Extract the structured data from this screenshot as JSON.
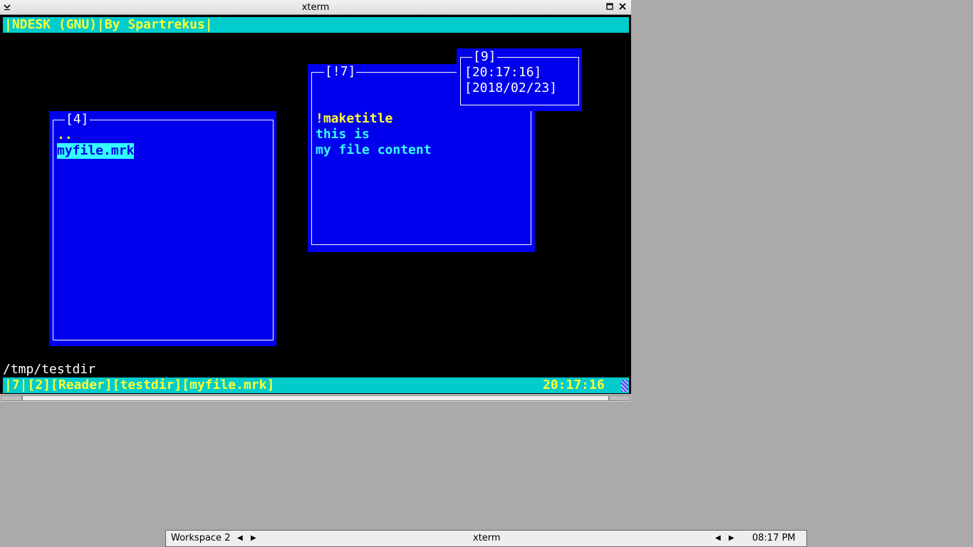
{
  "window": {
    "title": "xterm",
    "menu_icon": "chevron-down-icon",
    "maximize_icon": "maximize-icon",
    "close_icon": "close-icon"
  },
  "terminal": {
    "top_bar": "|NDESK (GNU)|By Spartrekus|",
    "windows": {
      "filelist": {
        "title": "[4]",
        "items": [
          "..",
          "myfile.mrk"
        ]
      },
      "reader": {
        "title": "[!7]",
        "lines": [
          "!maketitle",
          "this is",
          "my file content"
        ]
      },
      "clock": {
        "title": "[9]",
        "time": "[20:17:16]",
        "date": "[2018/02/23]"
      }
    },
    "path": "/tmp/testdir",
    "status_bar": {
      "left": "|7|[2][Reader][testdir][myfile.mrk]",
      "time": "20:17:16"
    }
  },
  "taskbar": {
    "workspace": "Workspace 2",
    "window_name": "xterm",
    "clock": "08:17 PM"
  },
  "colors": {
    "terminal_bg": "#000000",
    "window_blue": "#0000ee",
    "bar_cyan": "#00cccc",
    "yellow": "#ffff33",
    "cyan_text": "#33ffff"
  }
}
